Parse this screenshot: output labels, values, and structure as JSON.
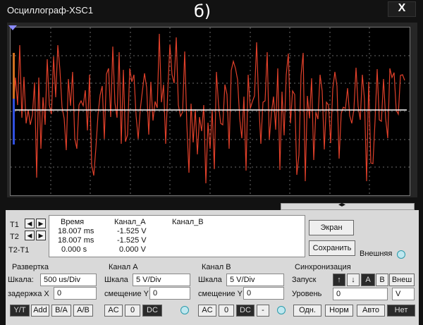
{
  "window": {
    "title": "Осциллограф-XSC1",
    "badge": "б)",
    "close_glyph": "X"
  },
  "colors": {
    "trace_a": "#e0402a",
    "trace_b": "#ffffff",
    "grid": "#6a6a6a",
    "screen_bg": "#000000"
  },
  "cursors": {
    "labels": {
      "t1": "T1",
      "t2": "T2",
      "t2t1": "T2-T1"
    },
    "headers": {
      "time": "Время",
      "ch_a": "Канал_A",
      "ch_b": "Канал_B"
    },
    "rows": [
      {
        "time": "18.007 ms",
        "a": "-1.525 V",
        "b": ""
      },
      {
        "time": "18.007 ms",
        "a": "-1.525 V",
        "b": ""
      },
      {
        "time": "0.000 s",
        "a": "0.000 V",
        "b": ""
      }
    ],
    "arrow_left": "◀",
    "arrow_right": "▶"
  },
  "actions": {
    "screen": "Экран",
    "save": "Сохранить",
    "external": "Внешняя"
  },
  "timebase": {
    "title": "Развертка",
    "scale_label": "Шкала:",
    "scale_value": "500 us/Div",
    "delay_label": "задержка X",
    "delay_value": "0",
    "modes": [
      "Y/T",
      "Add",
      "B/A",
      "A/B"
    ]
  },
  "channel_a": {
    "title": "Канал А",
    "scale_label": "Шкала",
    "scale_value": "5  V/Div",
    "offset_label": "смещение Y",
    "offset_value": "0",
    "coupling": [
      "AC",
      "0",
      "DC"
    ]
  },
  "channel_b": {
    "title": "Канал В",
    "scale_label": "Шкала",
    "scale_value": "5  V/Div",
    "offset_label": "смещение Y",
    "offset_value": "0",
    "coupling": [
      "AC",
      "0",
      "DC",
      "-"
    ]
  },
  "trigger": {
    "title": "Синхронизация",
    "start_label": "Запуск",
    "level_label": "Уровень",
    "level_value": "0",
    "level_unit": "V",
    "edge_buttons": [
      "↑",
      "↓",
      "A",
      "B",
      "Внеш"
    ],
    "modes": [
      "Одн.",
      "Норм",
      "Авто",
      "Нет"
    ]
  }
}
